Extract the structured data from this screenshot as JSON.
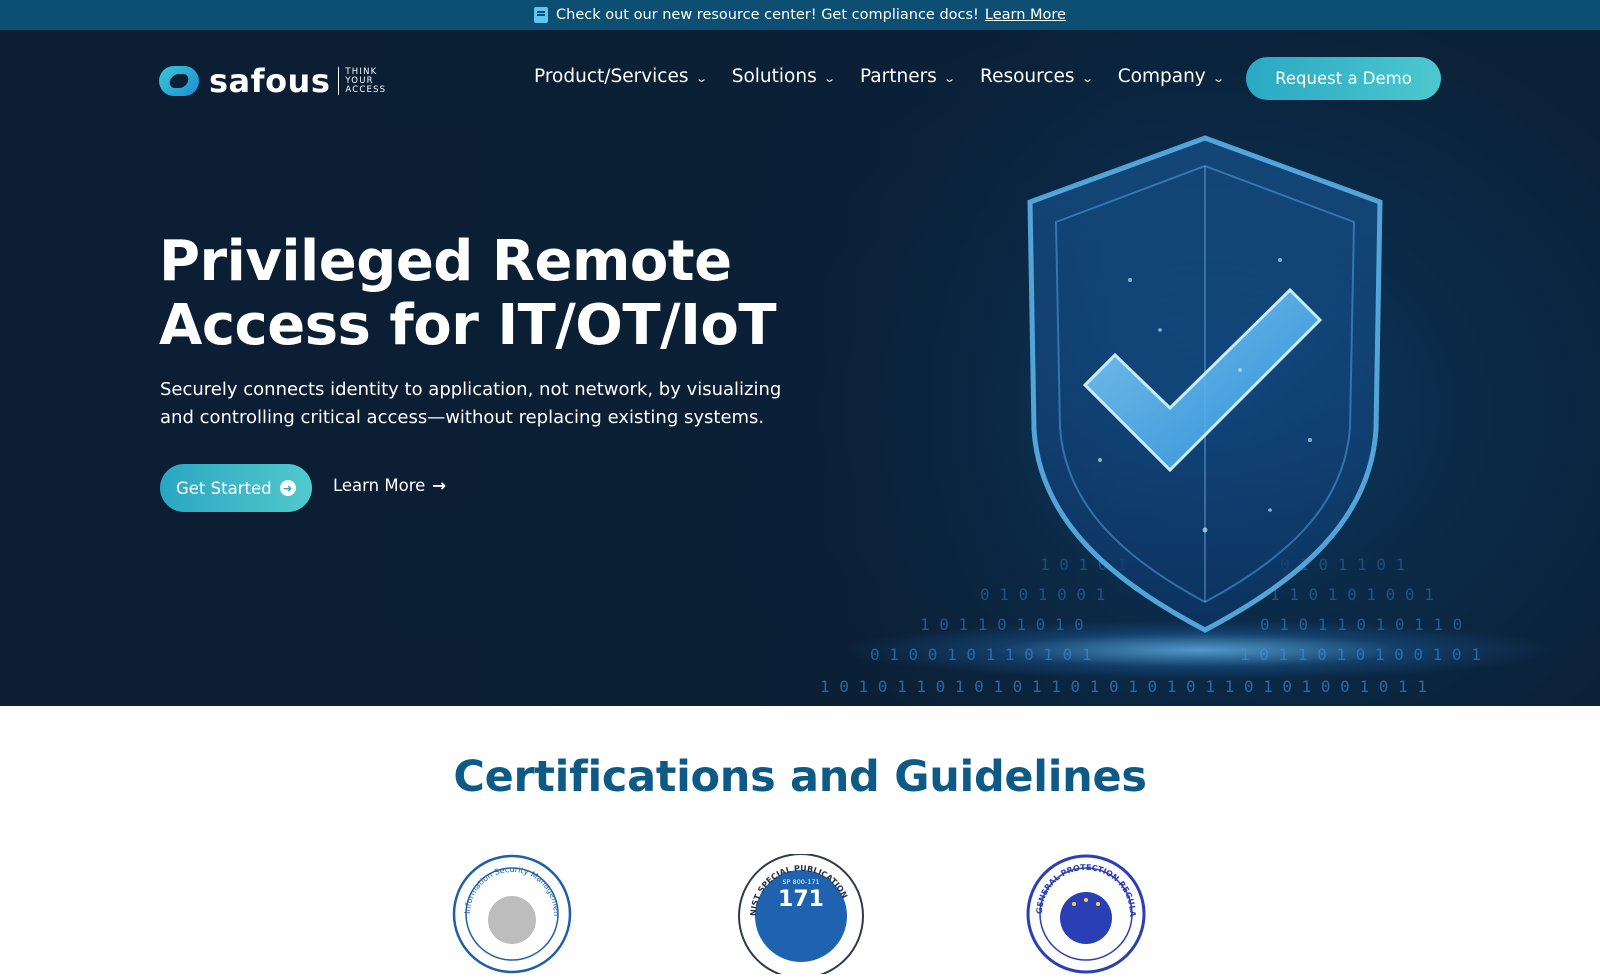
{
  "announcement": {
    "message": "Check out our new resource center! Get compliance docs!",
    "link": "Learn More"
  },
  "header": {
    "logo_word": "safous",
    "logo_tagline": [
      "THINK",
      "YOUR",
      "ACCESS"
    ],
    "nav": [
      {
        "label": "Product/Services"
      },
      {
        "label": "Solutions"
      },
      {
        "label": "Partners"
      },
      {
        "label": "Resources"
      },
      {
        "label": "Company"
      }
    ],
    "demo_button": "Request a Demo"
  },
  "hero": {
    "title_line1": "Privileged Remote",
    "title_line2": "Access for IT/OT/IoT",
    "subtitle_line1": "Securely connects identity to application, not network, by visualizing",
    "subtitle_line2": "and controlling critical access—without replacing existing systems.",
    "primary_cta": "Get Started",
    "secondary_cta": "Learn More"
  },
  "certifications": {
    "title": "Certifications and Guidelines",
    "badges": [
      {
        "text": "Information Security Management System"
      },
      {
        "text": "NIST SPECIAL PUBLICATION",
        "code": "SP 800-171",
        "number": "171"
      },
      {
        "text": "GENERAL PROTECTION REGULATION"
      }
    ]
  },
  "colors": {
    "announcement_bg": "#0d4f73",
    "hero_bg": "#0b1e33",
    "accent": "#3bbdc9",
    "heading_blue": "#0e5a86"
  }
}
